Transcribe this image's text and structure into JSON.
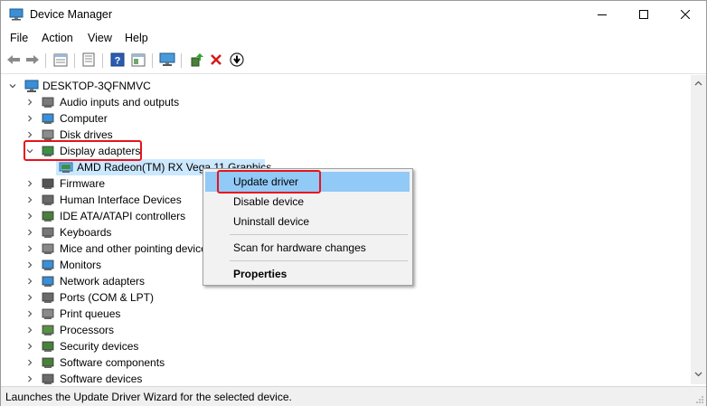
{
  "window": {
    "title": "Device Manager"
  },
  "menu": [
    "File",
    "Action",
    "View",
    "Help"
  ],
  "tree": {
    "root": "DESKTOP-3QFNMVC",
    "categories": [
      {
        "label": "Audio inputs and outputs",
        "icon": "speaker-icon"
      },
      {
        "label": "Computer",
        "icon": "computer-icon"
      },
      {
        "label": "Disk drives",
        "icon": "disk-drive-icon"
      },
      {
        "label": "Display adapters",
        "icon": "display-adapter-icon",
        "expanded": true
      },
      {
        "label": "Firmware",
        "icon": "firmware-icon"
      },
      {
        "label": "Human Interface Devices",
        "icon": "hid-icon"
      },
      {
        "label": "IDE ATA/ATAPI controllers",
        "icon": "ide-controller-icon"
      },
      {
        "label": "Keyboards",
        "icon": "keyboard-icon"
      },
      {
        "label": "Mice and other pointing devices",
        "icon": "mouse-icon"
      },
      {
        "label": "Monitors",
        "icon": "monitor-icon"
      },
      {
        "label": "Network adapters",
        "icon": "network-adapter-icon"
      },
      {
        "label": "Ports (COM & LPT)",
        "icon": "port-icon"
      },
      {
        "label": "Print queues",
        "icon": "printer-icon"
      },
      {
        "label": "Processors",
        "icon": "processor-icon"
      },
      {
        "label": "Security devices",
        "icon": "security-device-icon"
      },
      {
        "label": "Software components",
        "icon": "software-component-icon"
      },
      {
        "label": "Software devices",
        "icon": "software-device-icon"
      }
    ],
    "display_child": "AMD Radeon(TM) RX Vega 11 Graphics"
  },
  "context_menu": {
    "items": [
      "Update driver",
      "Disable device",
      "Uninstall device",
      "Scan for hardware changes",
      "Properties"
    ]
  },
  "status": {
    "text": "Launches the Update Driver Wizard for the selected device."
  },
  "colors": {
    "highlight_red": "#e8131b",
    "menu_hover": "#91c9f7",
    "selection": "#cce8ff"
  }
}
